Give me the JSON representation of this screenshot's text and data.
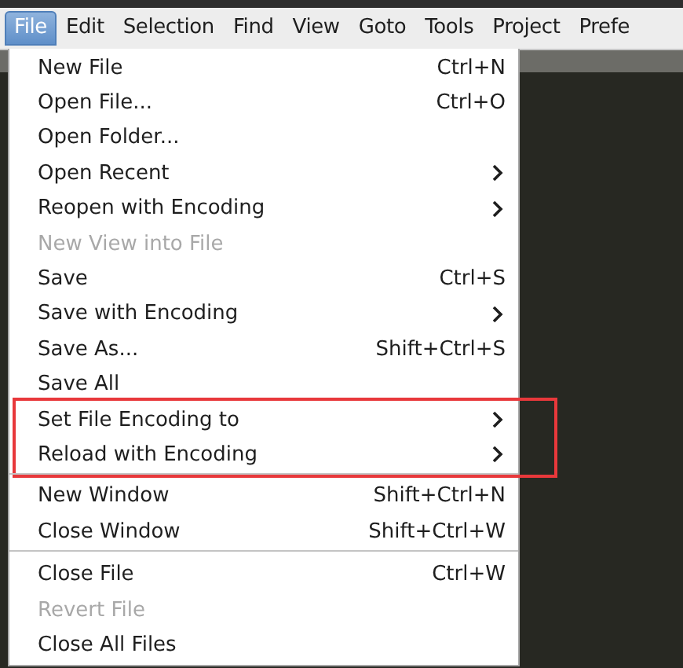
{
  "menubar": [
    {
      "label": "File",
      "selected": true
    },
    {
      "label": "Edit",
      "selected": false
    },
    {
      "label": "Selection",
      "selected": false
    },
    {
      "label": "Find",
      "selected": false
    },
    {
      "label": "View",
      "selected": false
    },
    {
      "label": "Goto",
      "selected": false
    },
    {
      "label": "Tools",
      "selected": false
    },
    {
      "label": "Project",
      "selected": false
    },
    {
      "label": "Prefe",
      "selected": false
    }
  ],
  "file_menu": {
    "groups": [
      {
        "highlighted": false,
        "items": [
          {
            "label": "New File",
            "shortcut": "Ctrl+N",
            "submenu": false,
            "disabled": false
          },
          {
            "label": "Open File...",
            "shortcut": "Ctrl+O",
            "submenu": false,
            "disabled": false
          },
          {
            "label": "Open Folder...",
            "submenu": false,
            "disabled": false
          },
          {
            "label": "Open Recent",
            "submenu": true,
            "disabled": false
          },
          {
            "label": "Reopen with Encoding",
            "submenu": true,
            "disabled": false
          },
          {
            "label": "New View into File",
            "submenu": false,
            "disabled": true
          },
          {
            "label": "Save",
            "shortcut": "Ctrl+S",
            "submenu": false,
            "disabled": false
          },
          {
            "label": "Save with Encoding",
            "submenu": true,
            "disabled": false
          },
          {
            "label": "Save As...",
            "shortcut": "Shift+Ctrl+S",
            "submenu": false,
            "disabled": false
          },
          {
            "label": "Save All",
            "submenu": false,
            "disabled": false
          }
        ]
      },
      {
        "highlighted": true,
        "items": [
          {
            "label": "Set File Encoding to",
            "submenu": true,
            "disabled": false
          },
          {
            "label": "Reload with Encoding",
            "submenu": true,
            "disabled": false
          }
        ]
      },
      {
        "highlighted": false,
        "items": [
          {
            "label": "New Window",
            "shortcut": "Shift+Ctrl+N",
            "submenu": false,
            "disabled": false
          },
          {
            "label": "Close Window",
            "shortcut": "Shift+Ctrl+W",
            "submenu": false,
            "disabled": false
          }
        ]
      },
      {
        "highlighted": false,
        "items": [
          {
            "label": "Close File",
            "shortcut": "Ctrl+W",
            "submenu": false,
            "disabled": false
          },
          {
            "label": "Revert File",
            "submenu": false,
            "disabled": true
          },
          {
            "label": "Close All Files",
            "submenu": false,
            "disabled": false
          }
        ]
      }
    ]
  }
}
